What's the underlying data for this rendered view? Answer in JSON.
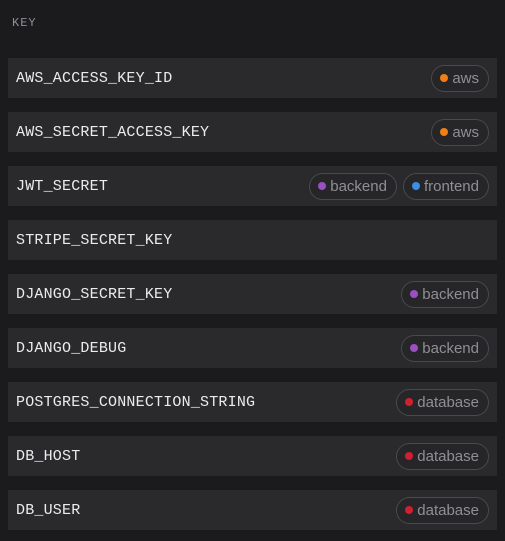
{
  "header": {
    "label": "KEY"
  },
  "tag_colors": {
    "aws": "#f07f14",
    "backend": "#9a4fc2",
    "frontend": "#3a8fe6",
    "database": "#d11f32"
  },
  "rows": [
    {
      "key": "AWS_ACCESS_KEY_ID",
      "tags": [
        "aws"
      ]
    },
    {
      "key": "AWS_SECRET_ACCESS_KEY",
      "tags": [
        "aws"
      ]
    },
    {
      "key": "JWT_SECRET",
      "tags": [
        "backend",
        "frontend"
      ]
    },
    {
      "key": "STRIPE_SECRET_KEY",
      "tags": []
    },
    {
      "key": "DJANGO_SECRET_KEY",
      "tags": [
        "backend"
      ]
    },
    {
      "key": "DJANGO_DEBUG",
      "tags": [
        "backend"
      ]
    },
    {
      "key": "POSTGRES_CONNECTION_STRING",
      "tags": [
        "database"
      ]
    },
    {
      "key": "DB_HOST",
      "tags": [
        "database"
      ]
    },
    {
      "key": "DB_USER",
      "tags": [
        "database"
      ]
    }
  ]
}
